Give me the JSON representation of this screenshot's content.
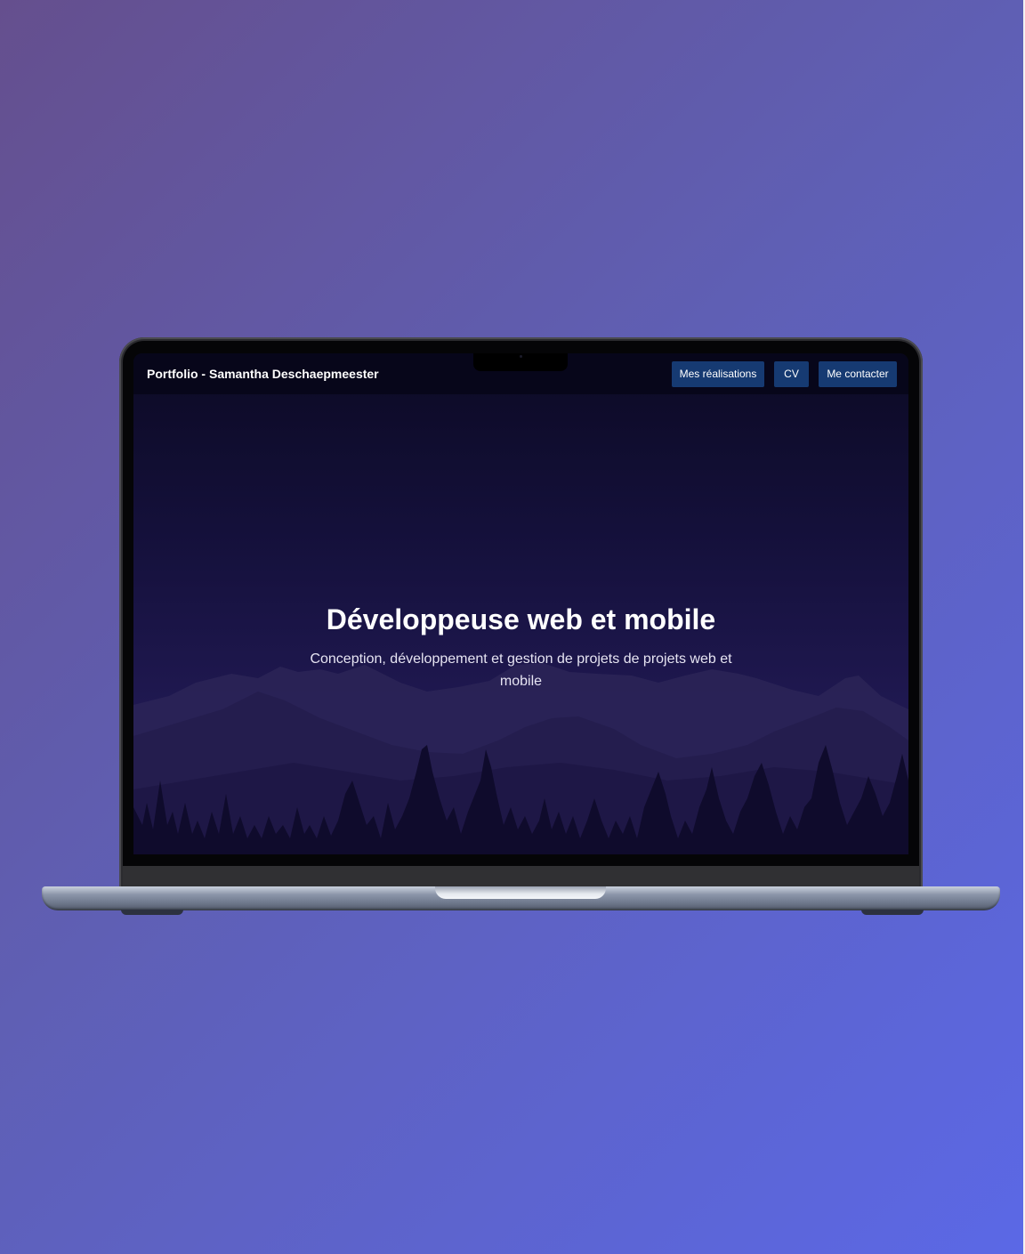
{
  "header": {
    "brand": "Portfolio - Samantha Deschaepmeester",
    "nav": [
      {
        "label": "Mes réalisations"
      },
      {
        "label": "CV"
      },
      {
        "label": "Me contacter"
      }
    ]
  },
  "hero": {
    "title": "Développeuse web et mobile",
    "subtitle": "Conception, développement et gestion de projets de projets web et mobile"
  },
  "colors": {
    "nav_button": "#163a72",
    "navbar": "#07061a",
    "hero_background": "#14103a",
    "page_gradient_start": "#654f8e",
    "page_gradient_end": "#5b68e6"
  },
  "icons": [
    "mountains-illustration",
    "pine-trees-illustration"
  ]
}
